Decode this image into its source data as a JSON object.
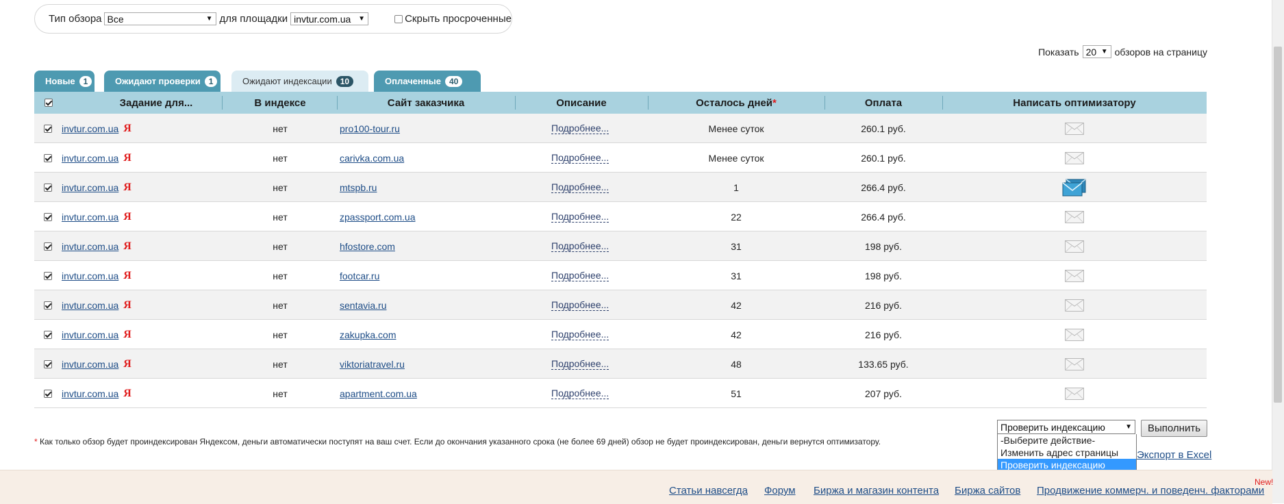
{
  "filter": {
    "type_label": "Тип обзора",
    "type_value": "Все",
    "platform_label": "для площадки",
    "platform_value": "invtur.com.ua",
    "hide_expired_label": "Скрыть просроченные"
  },
  "perpage": {
    "prefix": "Показать",
    "value": "20",
    "suffix": "обзоров на страницу"
  },
  "tabs": [
    {
      "label": "Новые",
      "count": "1"
    },
    {
      "label": "Ожидают проверки",
      "count": "1"
    },
    {
      "label": "Ожидают индексации",
      "count": "10"
    },
    {
      "label": "Оплаченные",
      "count": "40"
    }
  ],
  "columns": {
    "task": "Задание для...",
    "in_index": "В индексе",
    "client_site": "Сайт заказчика",
    "description": "Описание",
    "days_left": "Осталось дней",
    "days_left_star": "*",
    "payment": "Оплата",
    "write_optimizer": "Написать оптимизатору"
  },
  "rows": [
    {
      "task": "invtur.com.ua",
      "ya": "Я",
      "in_index": "нет",
      "site": "pro100-tour.ru",
      "desc": "Подробнее...",
      "days": "Менее суток",
      "pay": "260.1 руб.",
      "msg_icon": "envelope-icon"
    },
    {
      "task": "invtur.com.ua",
      "ya": "Я",
      "in_index": "нет",
      "site": "carivka.com.ua",
      "desc": "Подробнее...",
      "days": "Менее суток",
      "pay": "260.1 руб.",
      "msg_icon": "envelope-icon"
    },
    {
      "task": "invtur.com.ua",
      "ya": "Я",
      "in_index": "нет",
      "site": "mtspb.ru",
      "desc": "Подробнее...",
      "days": "1",
      "pay": "266.4 руб.",
      "msg_icon": "envelopes-blue-icon"
    },
    {
      "task": "invtur.com.ua",
      "ya": "Я",
      "in_index": "нет",
      "site": "zpassport.com.ua",
      "desc": "Подробнее...",
      "days": "22",
      "pay": "266.4 руб.",
      "msg_icon": "envelope-icon"
    },
    {
      "task": "invtur.com.ua",
      "ya": "Я",
      "in_index": "нет",
      "site": "hfostore.com",
      "desc": "Подробнее...",
      "days": "31",
      "pay": "198 руб.",
      "msg_icon": "envelope-icon"
    },
    {
      "task": "invtur.com.ua",
      "ya": "Я",
      "in_index": "нет",
      "site": "footcar.ru",
      "desc": "Подробнее...",
      "days": "31",
      "pay": "198 руб.",
      "msg_icon": "envelope-icon"
    },
    {
      "task": "invtur.com.ua",
      "ya": "Я",
      "in_index": "нет",
      "site": "sentavia.ru",
      "desc": "Подробнее...",
      "days": "42",
      "pay": "216 руб.",
      "msg_icon": "envelope-icon"
    },
    {
      "task": "invtur.com.ua",
      "ya": "Я",
      "in_index": "нет",
      "site": "zakupka.com",
      "desc": "Подробнее...",
      "days": "42",
      "pay": "216 руб.",
      "msg_icon": "envelope-icon"
    },
    {
      "task": "invtur.com.ua",
      "ya": "Я",
      "in_index": "нет",
      "site": "viktoriatravel.ru",
      "desc": "Подробнее...",
      "days": "48",
      "pay": "133.65 руб.",
      "msg_icon": "envelope-icon"
    },
    {
      "task": "invtur.com.ua",
      "ya": "Я",
      "in_index": "нет",
      "site": "apartment.com.ua",
      "desc": "Подробнее...",
      "days": "51",
      "pay": "207 руб.",
      "msg_icon": "envelope-icon"
    }
  ],
  "footnote": {
    "star": "*",
    "text": "Как только обзор будет проиндексирован Яндексом, деньги автоматически поступят на ваш счет. Если до окончания указанного срока (не более 69 дней) обзор не будет проиндексирован, деньги вернутся оптимизатору."
  },
  "actions": {
    "selected": "Проверить индексацию",
    "options": [
      "-Выберите действие-",
      "Изменить адрес страницы",
      "Проверить индексацию"
    ],
    "run_label": "Выполнить",
    "export_label": "Экспорт в Excel"
  },
  "footer": {
    "links": [
      "Статьи навсегда",
      "Форум",
      "Биржа и магазин контента",
      "Биржа сайтов",
      "Продвижение коммерч. и поведенч. факторами"
    ],
    "new_badge": "New!"
  }
}
